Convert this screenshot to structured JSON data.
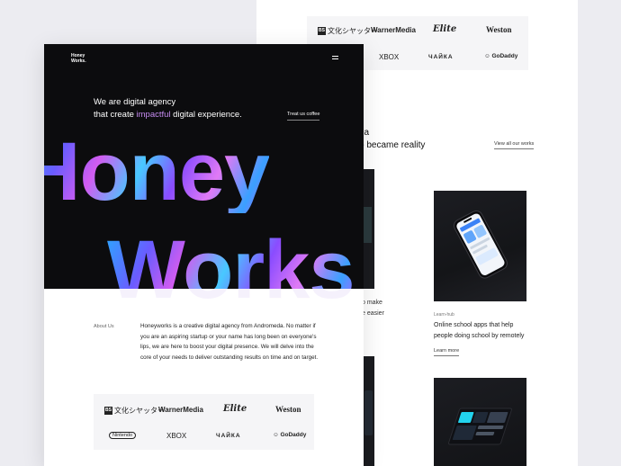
{
  "back_page": {
    "logos_row1": [
      "文化シヤッター",
      "WarnerMedia",
      "Elite",
      "Weston"
    ],
    "logos_row2": [
      "XBOX",
      "ЧАЙКА",
      "GoDaddy"
    ],
    "heading_line1": "ea",
    "heading_line2": "o became reality",
    "view_all_link": "View all our works",
    "peek_text_line1": "o make",
    "peek_text_line2": "e easier",
    "card": {
      "tag": "Learn-hub",
      "description": "Online school apps that help people doing school by remotely",
      "link": "Learn more"
    }
  },
  "front_page": {
    "brand_line1": "Honey",
    "brand_line2": "Works.",
    "tagline_line1": "We are digital agency",
    "tagline_line2_pre": "that create ",
    "tagline_accent": "impactful",
    "tagline_line2_post": " digital experience.",
    "cta": "Treat us coffee",
    "hero_word1": "Honey",
    "hero_word2": "Works",
    "about_label": "About Us",
    "about_text": "Honeyworks is a creative digital agency from Andromeda. No matter if you are an aspiring startup or your name has long been on everyone's lips, we are here to boost your digital presence. We will delve into the core of your needs to deliver outstanding results on time and on target.",
    "logos_row1": [
      "文化シヤッター",
      "WarnerMedia",
      "Elite",
      "Weston"
    ],
    "logos_row2": [
      "Nintendo",
      "XBOX",
      "ЧАЙКА",
      "GoDaddy"
    ]
  },
  "colors": {
    "accent": "#c58bf0",
    "hero_bg": "#0c0c0e",
    "page_bg": "#ececf1"
  }
}
